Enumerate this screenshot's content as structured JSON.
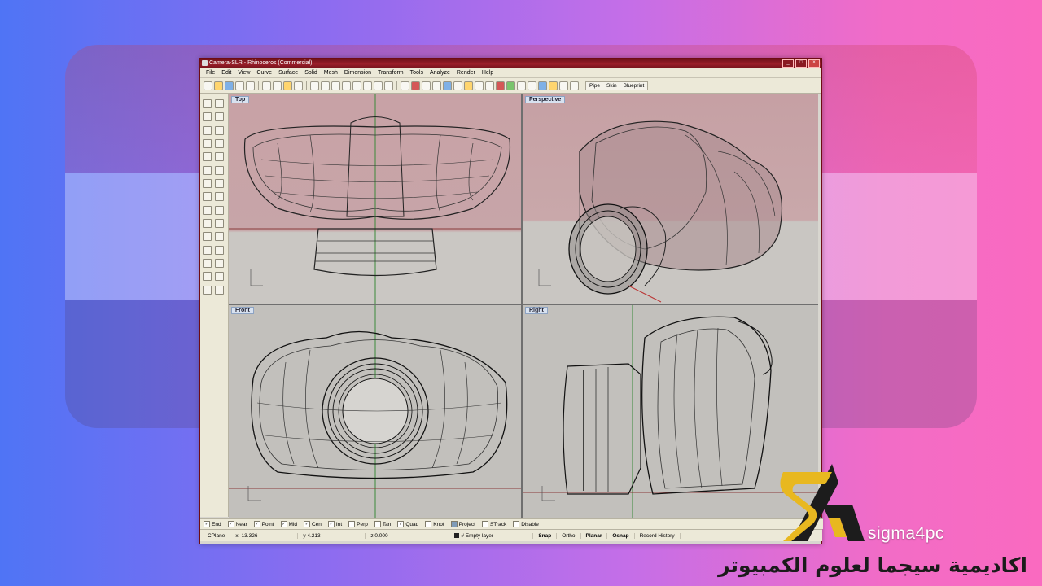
{
  "window": {
    "title": "Camera-SLR - Rhinoceros (Commercial)"
  },
  "menu": [
    "File",
    "Edit",
    "View",
    "Curve",
    "Surface",
    "Solid",
    "Mesh",
    "Dimension",
    "Transform",
    "Tools",
    "Analyze",
    "Render",
    "Help"
  ],
  "toolbar_tabs": [
    "Pipe",
    "Skin",
    "Blueprint"
  ],
  "viewports": {
    "top": "Top",
    "perspective": "Perspective",
    "front": "Front",
    "right": "Right"
  },
  "osnaps": [
    {
      "label": "End",
      "checked": true
    },
    {
      "label": "Near",
      "checked": true
    },
    {
      "label": "Point",
      "checked": true
    },
    {
      "label": "Mid",
      "checked": true
    },
    {
      "label": "Cen",
      "checked": true
    },
    {
      "label": "Int",
      "checked": true
    },
    {
      "label": "Perp",
      "checked": false
    },
    {
      "label": "Tan",
      "checked": false
    },
    {
      "label": "Quad",
      "checked": true
    },
    {
      "label": "Knot",
      "checked": false
    },
    {
      "label": "Project",
      "checked": false
    },
    {
      "label": "STrack",
      "checked": false
    },
    {
      "label": "Disable",
      "checked": false
    }
  ],
  "status": {
    "cplane": "CPlane",
    "x": "x -13.326",
    "y": "y 4.213",
    "z": "z 0.000",
    "layer": "# Empty layer",
    "snap": "Snap",
    "ortho": "Ortho",
    "planar": "Planar",
    "osnap": "Osnap",
    "record": "Record History"
  },
  "brand": {
    "name": "sigma4pc",
    "arabic": "اكاديمية سيجما لعلوم الكمبيوتر",
    "colors": {
      "gold": "#e8b820",
      "dark": "#1c1c1c"
    }
  }
}
